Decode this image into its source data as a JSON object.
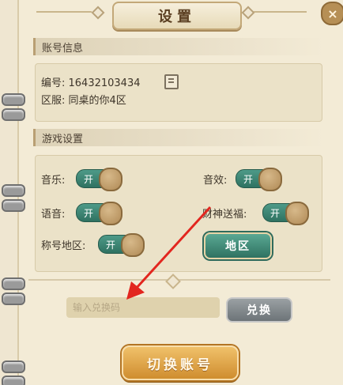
{
  "title": "设置",
  "close_icon_glyph": "×",
  "account": {
    "heading": "账号信息",
    "id_line": "编号: 16432103434",
    "server_line": "区服: 同桌的你4区"
  },
  "game_settings": {
    "heading": "游戏设置",
    "toggles": {
      "music": {
        "label": "音乐:",
        "state": "开"
      },
      "sfx": {
        "label": "音效:",
        "state": "开"
      },
      "voice": {
        "label": "语音:",
        "state": "开"
      },
      "fortune": {
        "label": "财神送福:",
        "state": "开"
      },
      "title_region": {
        "label": "称号地区:",
        "state": "开"
      }
    },
    "region_button": "地区"
  },
  "redeem": {
    "placeholder": "输入兑换码",
    "button": "兑换"
  },
  "switch_account_button": "切换账号",
  "colors": {
    "accent_green": "#2f7261",
    "accent_gold": "#cf8d2f",
    "annotation_red": "#e2261f"
  }
}
